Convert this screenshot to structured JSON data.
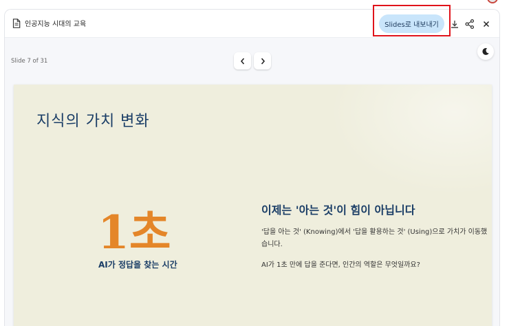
{
  "doc": {
    "title": "인공지능 시대의 교육",
    "icon": "document-icon"
  },
  "toolbar": {
    "export_label": "Slides로 내보내기",
    "download_icon": "download-icon",
    "share_icon": "share-icon",
    "close_icon": "close-icon"
  },
  "viewer": {
    "slide_counter": "Slide 7 of 31",
    "prev_icon": "chevron-left-icon",
    "next_icon": "chevron-right-icon",
    "theme_icon": "moon-icon"
  },
  "slide": {
    "title": "지식의 가치 변화",
    "big_number": "1초",
    "big_caption": "AI가 정답을 찾는 시간",
    "heading": "이제는 '아는 것'이 힘이 아닙니다",
    "paragraph1": "'답을 아는 것' (Knowing)에서 '답을 활용하는 것' (Using)으로 가치가 이동했습니다.",
    "paragraph2": "AI가 1초 만에 답을 준다면, 인간의 역할은 무엇일까요?"
  },
  "colors": {
    "title_blue": "#1a3d66",
    "accent_orange": "#e48629",
    "slide_bg": "#efeedd",
    "export_button_bg": "#c9e5fb",
    "highlight_red": "#e0121a"
  }
}
